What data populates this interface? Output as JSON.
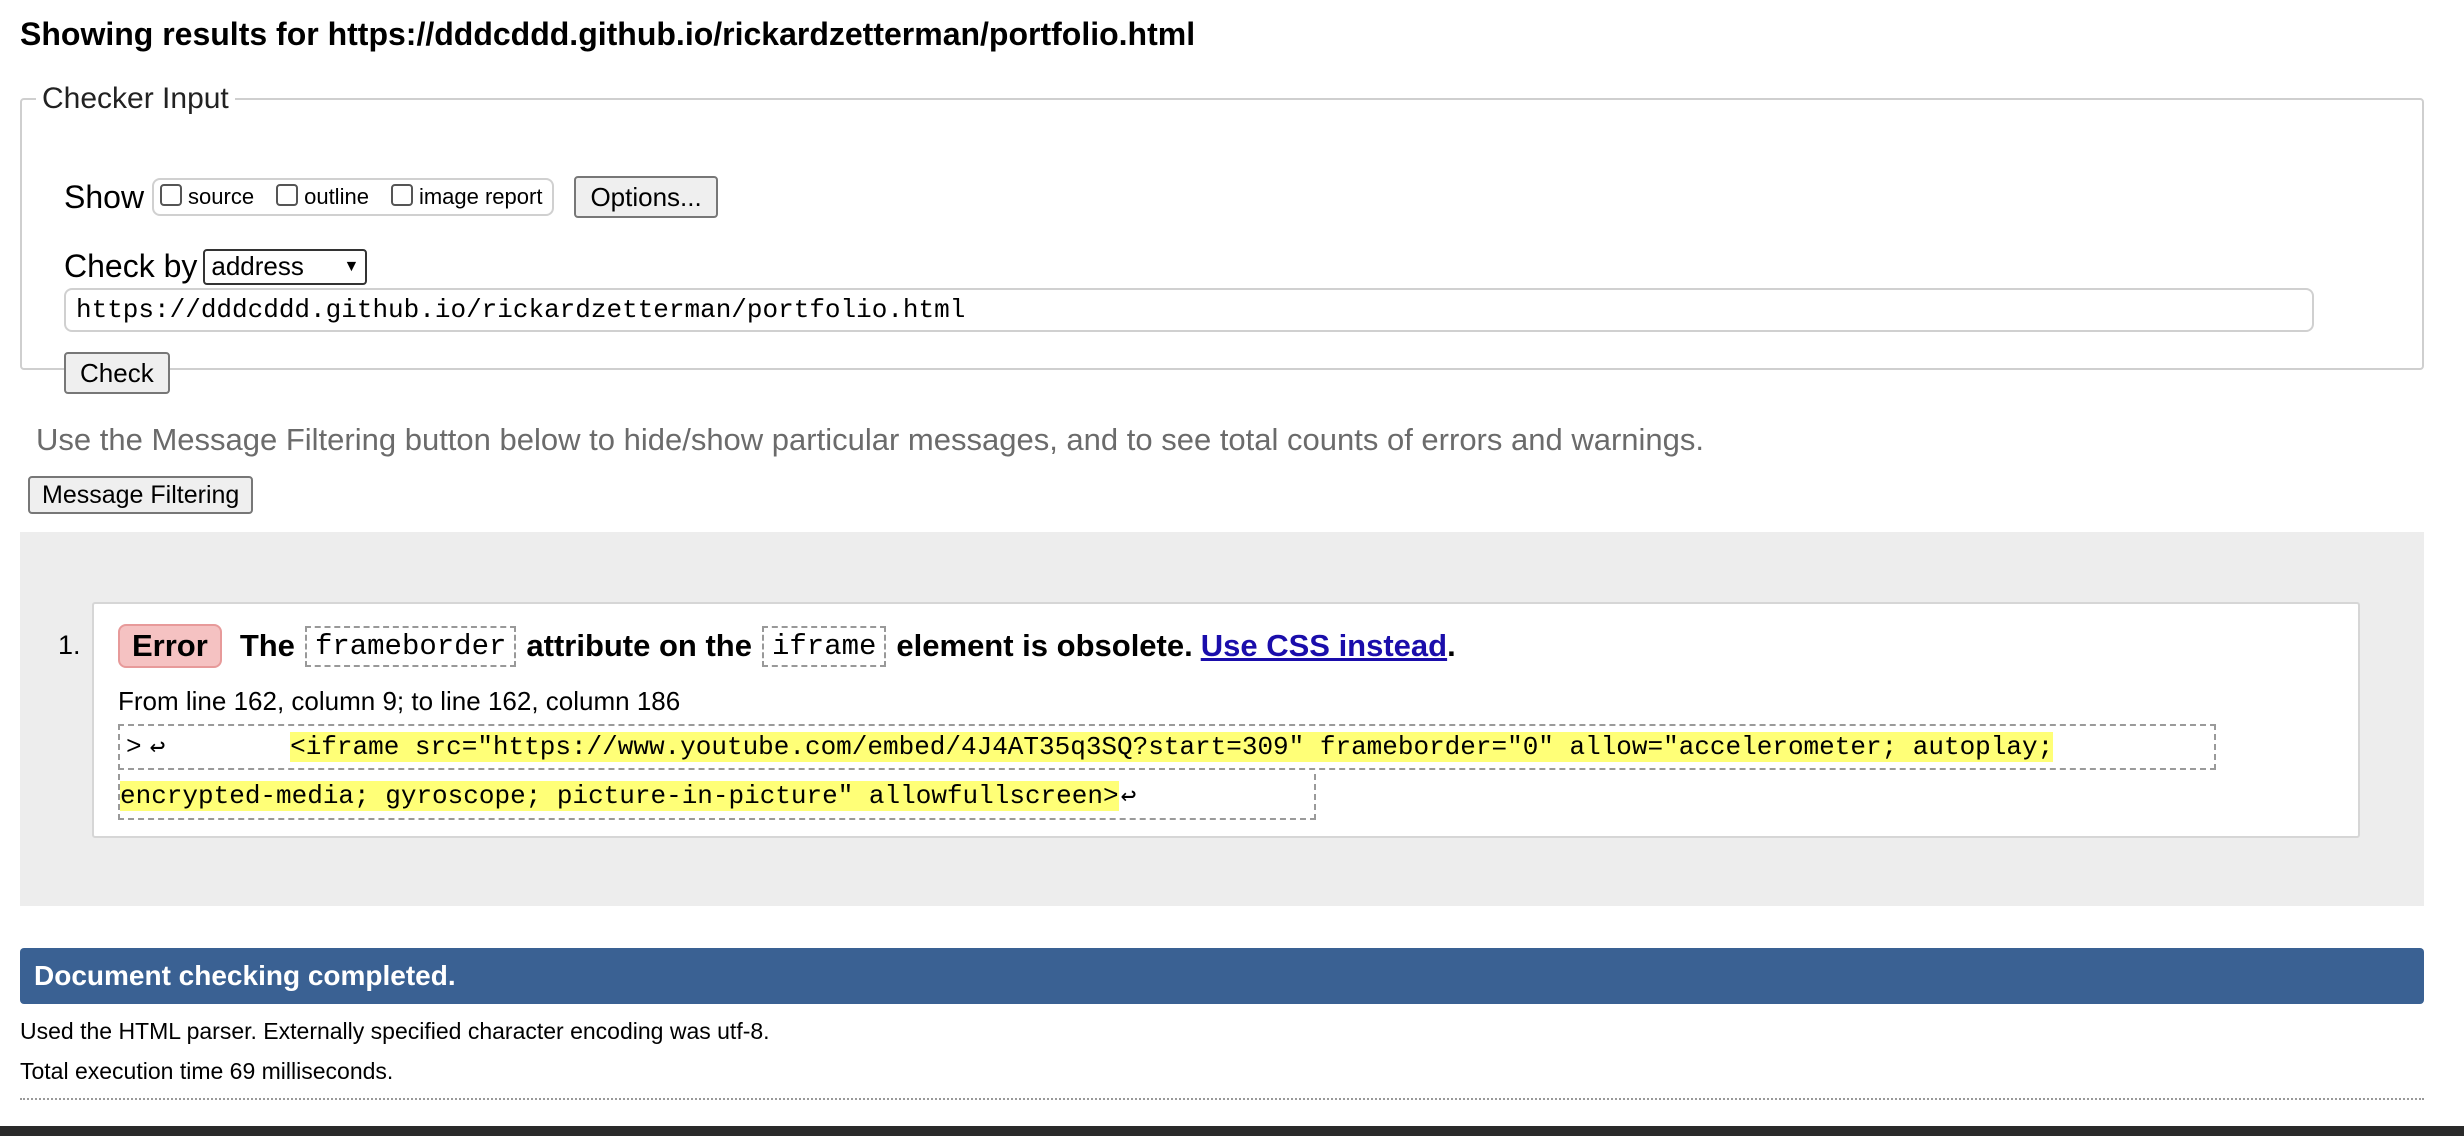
{
  "header": {
    "title": "Showing results for https://dddcddd.github.io/rickardzetterman/portfolio.html"
  },
  "checker": {
    "legend": "Checker Input",
    "show_label": "Show",
    "show_options": [
      {
        "label": "source",
        "checked": false
      },
      {
        "label": "outline",
        "checked": false
      },
      {
        "label": "image report",
        "checked": false
      }
    ],
    "options_button": "Options...",
    "check_by_label": "Check by",
    "check_by_selected": "address",
    "url_value": "https://dddcddd.github.io/rickardzetterman/portfolio.html",
    "check_button": "Check"
  },
  "filtering": {
    "note": "Use the Message Filtering button below to hide/show particular messages, and to see total counts of errors and warnings.",
    "button": "Message Filtering"
  },
  "messages": [
    {
      "number": "1.",
      "type": "Error",
      "text_1": "The",
      "code_1": "frameborder",
      "text_2": "attribute on the",
      "code_2": "iframe",
      "text_3": "element is obsolete.",
      "link": "Use CSS instead",
      "suffix": ".",
      "location": "From line 162, column 9; to line 162, column 186",
      "extract_prefix": ">",
      "extract_indent": "        ",
      "extract_highlight_1": "<iframe src=\"https://www.youtube.com/embed/4J4AT35q3SQ?start=309\" frameborder=\"0\" allow=\"accelerometer; autoplay;",
      "extract_highlight_2": "encrypted-media; gyroscope; picture-in-picture\" allowfullscreen>",
      "return_symbol": "↩"
    }
  ],
  "status": {
    "completed": "Document checking completed.",
    "parser_info": "Used the HTML parser. Externally specified character encoding was utf-8.",
    "execution_time": "Total execution time 69 milliseconds."
  },
  "colors": {
    "status_bar": "#3a6193",
    "error_badge": "#f5c2c2",
    "highlight": "#ffff77",
    "link": "#1a0dab"
  }
}
